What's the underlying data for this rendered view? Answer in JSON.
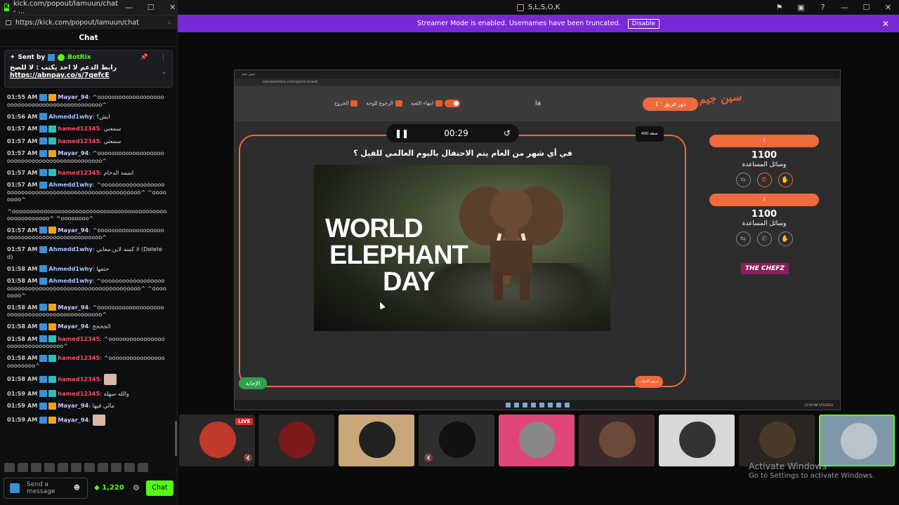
{
  "chat_window": {
    "title": "kick.com/popout/lamuun/chat - ...",
    "url": "https://kick.com/popout/lamuun/chat",
    "header": "Chat",
    "pinned": {
      "sent_by": "Sent by",
      "bot_name": "BotRix",
      "link": "https://abnpay.co/s/7qefcE",
      "text": "رابط الدعم لا احد يكتب : لا للضح"
    },
    "messages": [
      {
        "time": "01:55 AM",
        "user": "Mayar_94",
        "style": "mayar",
        "badges": [
          "blue",
          "crown"
        ],
        "text": "^oooooooooooooooooooooooooooooooooooooooooooooo^"
      },
      {
        "time": "01:56 AM",
        "user": "Ahmedd1why",
        "style": "ahmed",
        "badges": [
          "blue"
        ],
        "text": "ايش؟"
      },
      {
        "time": "01:57 AM",
        "user": "hamed12345",
        "style": "hamed",
        "badges": [
          "blue",
          "sub"
        ],
        "text": "سمعتي"
      },
      {
        "time": "01:57 AM",
        "user": "hamed12345",
        "style": "hamed",
        "badges": [
          "blue",
          "sub"
        ],
        "text": "سمعتي"
      },
      {
        "time": "01:57 AM",
        "user": "Mayar_94",
        "style": "mayar",
        "badges": [
          "blue",
          "crown"
        ],
        "text": "^oooooooooooooooooooooooooooooooooooooooooooooo^"
      },
      {
        "time": "01:57 AM",
        "user": "hamed12345",
        "style": "hamed",
        "badges": [
          "blue",
          "sub"
        ],
        "text": "اسمه الدحام"
      },
      {
        "time": "01:57 AM",
        "user": "Ahmedd1why",
        "style": "ahmed",
        "badges": [
          "blue"
        ],
        "text": "^oooooooooooooooooooooooooooooooooooooooooooooooooooooooo^ ^oooooooo^"
      },
      {
        "time": "",
        "user": "",
        "style": "ahmed",
        "badges": [],
        "text": "^oooooooooooooooooooooooooooooooooooooooooooooooooooooooo^ ^oooooooo^"
      },
      {
        "time": "01:57 AM",
        "user": "Mayar_94",
        "style": "mayar",
        "badges": [
          "blue",
          "crown"
        ],
        "text": "^oooooooooooooooooooooooooooooooooooooooooooooo^"
      },
      {
        "time": "01:57 AM",
        "user": "Ahmedd1why",
        "style": "ahmed",
        "badges": [
          "blue"
        ],
        "text": "لا كسه لاين معاني (Deleted)"
      },
      {
        "time": "01:58 AM",
        "user": "Ahmedd1why",
        "style": "ahmed",
        "badges": [
          "blue"
        ],
        "text": "حتفها"
      },
      {
        "time": "01:58 AM",
        "user": "Ahmedd1why",
        "style": "ahmed",
        "badges": [
          "blue"
        ],
        "text": "^oooooooooooooooooooooooooooooooooooooooooooooooooooooooo^ ^oooooooo^"
      },
      {
        "time": "01:58 AM",
        "user": "Mayar_94",
        "style": "mayar",
        "badges": [
          "blue",
          "crown"
        ],
        "text": "^oooooooooooooooooooooooooooooooooooooooooooooo^"
      },
      {
        "time": "01:58 AM",
        "user": "Mayar_94",
        "style": "mayar",
        "badges": [
          "blue",
          "crown"
        ],
        "text": "الخخخخ"
      },
      {
        "time": "01:58 AM",
        "user": "hamed12345",
        "style": "hamed",
        "badges": [
          "blue",
          "sub"
        ],
        "text": "^oooooooooooooooooooooooooooooooo^"
      },
      {
        "time": "01:58 AM",
        "user": "hamed12345",
        "style": "hamed",
        "badges": [
          "blue",
          "sub"
        ],
        "text": "^oooooooooooooooooooooooo^"
      },
      {
        "time": "01:58 AM",
        "user": "hamed12345",
        "style": "hamed",
        "badges": [
          "blue",
          "sub"
        ],
        "text": ""
      },
      {
        "time": "01:59 AM",
        "user": "hamed12345",
        "style": "hamed",
        "badges": [
          "blue",
          "sub"
        ],
        "text": "والله سهله"
      },
      {
        "time": "01:59 AM",
        "user": "Mayar_94",
        "style": "mayar",
        "badges": [
          "blue",
          "crown"
        ],
        "text": "مالي فيها"
      },
      {
        "time": "01:59 AM",
        "user": "Mayar_94",
        "style": "mayar",
        "badges": [
          "blue",
          "crown"
        ],
        "text": ""
      }
    ],
    "input_placeholder": "Send a message",
    "points": "1,220",
    "chat_button": "Chat"
  },
  "top_bar": {
    "title": "S,L,S,O,K"
  },
  "streamer_banner": {
    "text": "Streamer Mode is enabled. Usernames have been truncated.",
    "button": "Disable"
  },
  "game": {
    "browser_title": "سين جيم",
    "browser_url": "seenjeemlive.com/game-board",
    "logo": "سين جيم",
    "turn_label": "دور فريق : 1",
    "header_text": "la",
    "options": {
      "exit": "الخروج",
      "back_board": "الرجوع للوحة",
      "end_game": "انتهاء اللعبة"
    },
    "timer": "00:29",
    "points_badge": "400 نقطة",
    "question": "في أي شهر من العام يتم الاحتفال باليوم العالمي للفيل ؟",
    "image_text": [
      "WORLD",
      "ELEPHANT",
      "DAY"
    ],
    "answer_button": "الإجابة",
    "show_answer": "عرض الجواب",
    "teams": [
      {
        "name": "1",
        "score": "1100",
        "label": "وسائل المساعدة"
      },
      {
        "name": "2",
        "score": "1100",
        "label": "وسائل المساعدة"
      }
    ],
    "sponsor": "THE CHEFZ",
    "taskbar_time": "12:29 AM 1/15/2025"
  },
  "participants": {
    "live_label": "LIVE",
    "tiles": [
      {
        "bg": "#2a2727",
        "avatar": "#c0392b"
      },
      {
        "bg": "#2a2727",
        "avatar": "#7a1a1a"
      },
      {
        "bg": "#c9a77b",
        "avatar": "#222"
      },
      {
        "bg": "#2f2f2f",
        "avatar": "#111"
      },
      {
        "bg": "#e0457b",
        "avatar": "#888"
      },
      {
        "bg": "#3a2a2a",
        "avatar": "#6a4a3a"
      },
      {
        "bg": "#d8d8d8",
        "avatar": "#333"
      },
      {
        "bg": "#2a2520",
        "avatar": "#4a3a2a"
      },
      {
        "bg": "#7f97a8",
        "avatar": "#b9c3cc"
      }
    ]
  },
  "watermark": {
    "line1": "Activate Windows",
    "line2": "Go to Settings to activate Windows."
  },
  "colors": {
    "kick_green": "#53fc18",
    "banner_purple": "#7a29d6",
    "game_orange": "#f06a3c"
  }
}
